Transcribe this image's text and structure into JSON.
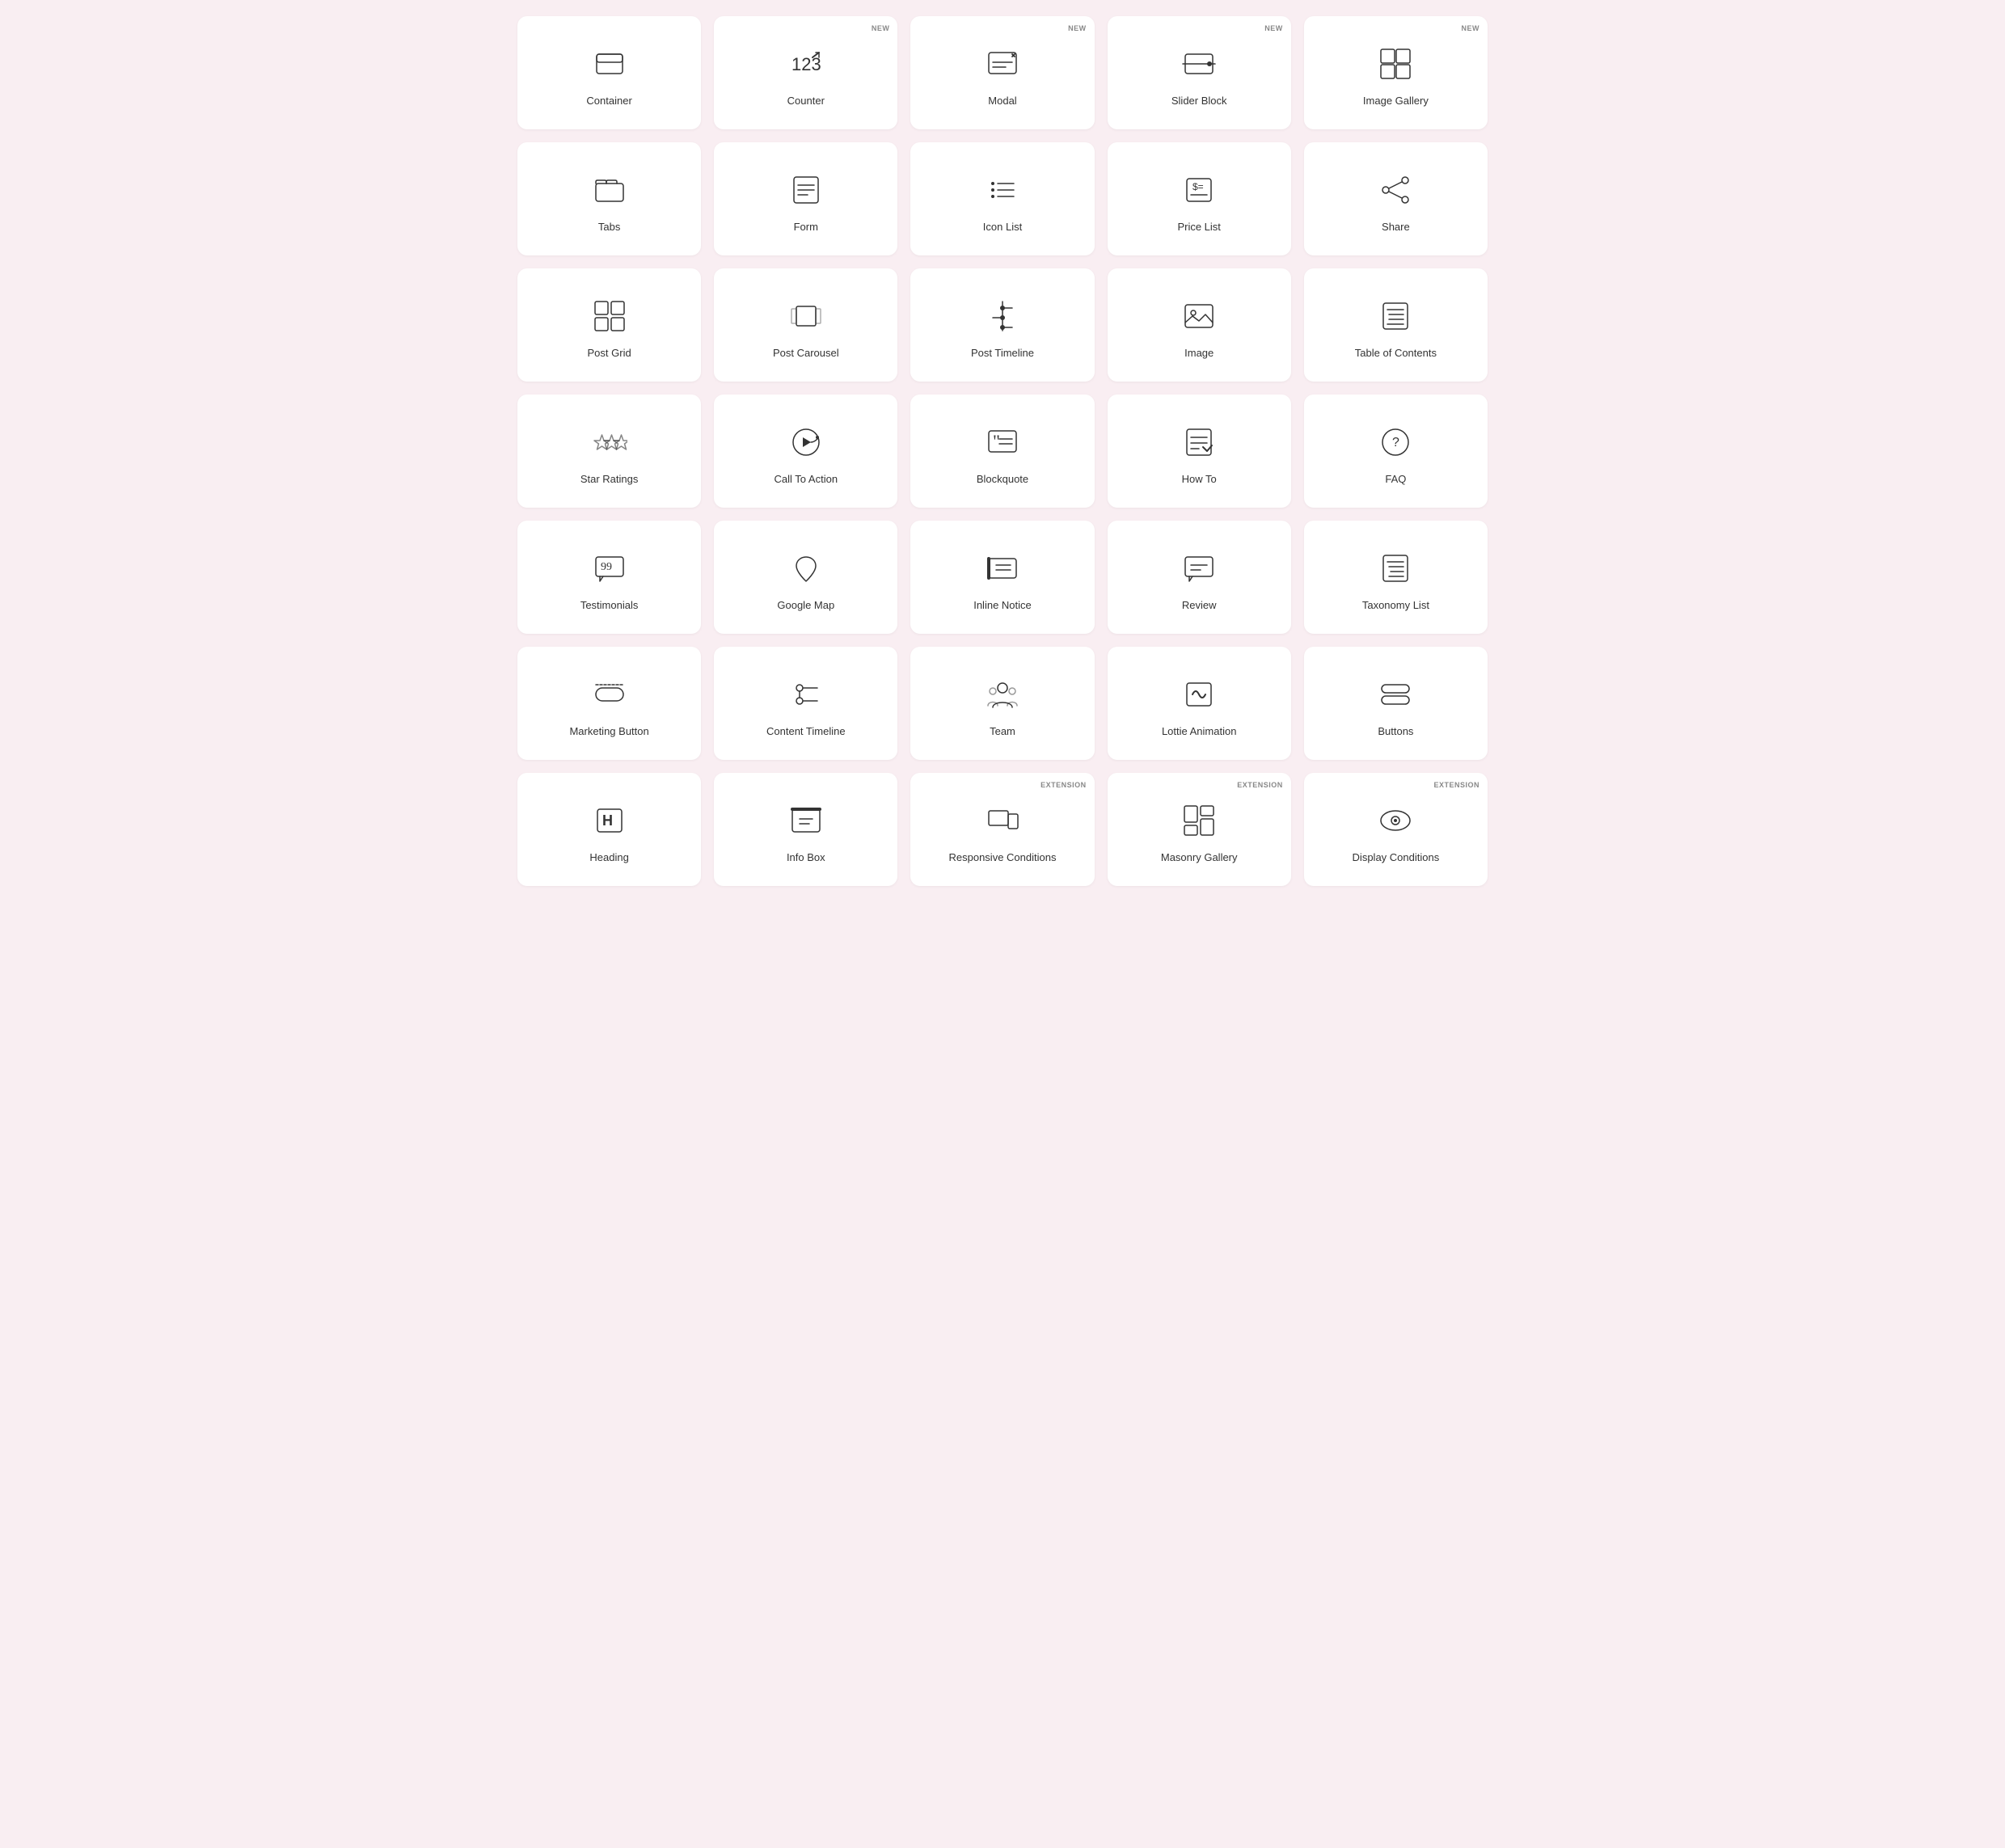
{
  "items": [
    {
      "id": "container",
      "label": "Container",
      "badge": null,
      "icon": "container"
    },
    {
      "id": "counter",
      "label": "Counter",
      "badge": "NEW",
      "icon": "counter"
    },
    {
      "id": "modal",
      "label": "Modal",
      "badge": "NEW",
      "icon": "modal"
    },
    {
      "id": "slider-block",
      "label": "Slider Block",
      "badge": "NEW",
      "icon": "slider-block"
    },
    {
      "id": "image-gallery",
      "label": "Image Gallery",
      "badge": "NEW",
      "icon": "image-gallery"
    },
    {
      "id": "tabs",
      "label": "Tabs",
      "badge": null,
      "icon": "tabs"
    },
    {
      "id": "form",
      "label": "Form",
      "badge": null,
      "icon": "form"
    },
    {
      "id": "icon-list",
      "label": "Icon List",
      "badge": null,
      "icon": "icon-list"
    },
    {
      "id": "price-list",
      "label": "Price List",
      "badge": null,
      "icon": "price-list"
    },
    {
      "id": "share",
      "label": "Share",
      "badge": null,
      "icon": "share"
    },
    {
      "id": "post-grid",
      "label": "Post Grid",
      "badge": null,
      "icon": "post-grid"
    },
    {
      "id": "post-carousel",
      "label": "Post Carousel",
      "badge": null,
      "icon": "post-carousel"
    },
    {
      "id": "post-timeline",
      "label": "Post Timeline",
      "badge": null,
      "icon": "post-timeline"
    },
    {
      "id": "image",
      "label": "Image",
      "badge": null,
      "icon": "image"
    },
    {
      "id": "table-of-contents",
      "label": "Table of Contents",
      "badge": null,
      "icon": "table-of-contents"
    },
    {
      "id": "star-ratings",
      "label": "Star Ratings",
      "badge": null,
      "icon": "star-ratings"
    },
    {
      "id": "call-to-action",
      "label": "Call To Action",
      "badge": null,
      "icon": "call-to-action"
    },
    {
      "id": "blockquote",
      "label": "Blockquote",
      "badge": null,
      "icon": "blockquote"
    },
    {
      "id": "how-to",
      "label": "How To",
      "badge": null,
      "icon": "how-to"
    },
    {
      "id": "faq",
      "label": "FAQ",
      "badge": null,
      "icon": "faq"
    },
    {
      "id": "testimonials",
      "label": "Testimonials",
      "badge": null,
      "icon": "testimonials"
    },
    {
      "id": "google-map",
      "label": "Google Map",
      "badge": null,
      "icon": "google-map"
    },
    {
      "id": "inline-notice",
      "label": "Inline Notice",
      "badge": null,
      "icon": "inline-notice"
    },
    {
      "id": "review",
      "label": "Review",
      "badge": null,
      "icon": "review"
    },
    {
      "id": "taxonomy-list",
      "label": "Taxonomy List",
      "badge": null,
      "icon": "taxonomy-list"
    },
    {
      "id": "marketing-button",
      "label": "Marketing Button",
      "badge": null,
      "icon": "marketing-button"
    },
    {
      "id": "content-timeline",
      "label": "Content Timeline",
      "badge": null,
      "icon": "content-timeline"
    },
    {
      "id": "team",
      "label": "Team",
      "badge": null,
      "icon": "team"
    },
    {
      "id": "lottie-animation",
      "label": "Lottie Animation",
      "badge": null,
      "icon": "lottie-animation"
    },
    {
      "id": "buttons",
      "label": "Buttons",
      "badge": null,
      "icon": "buttons"
    },
    {
      "id": "heading",
      "label": "Heading",
      "badge": null,
      "icon": "heading"
    },
    {
      "id": "info-box",
      "label": "Info Box",
      "badge": null,
      "icon": "info-box"
    },
    {
      "id": "responsive-conditions",
      "label": "Responsive Conditions",
      "badge": "EXTENSION",
      "icon": "responsive-conditions"
    },
    {
      "id": "masonry-gallery",
      "label": "Masonry Gallery",
      "badge": "EXTENSION",
      "icon": "masonry-gallery"
    },
    {
      "id": "display-conditions",
      "label": "Display Conditions",
      "badge": "EXTENSION",
      "icon": "display-conditions"
    }
  ]
}
